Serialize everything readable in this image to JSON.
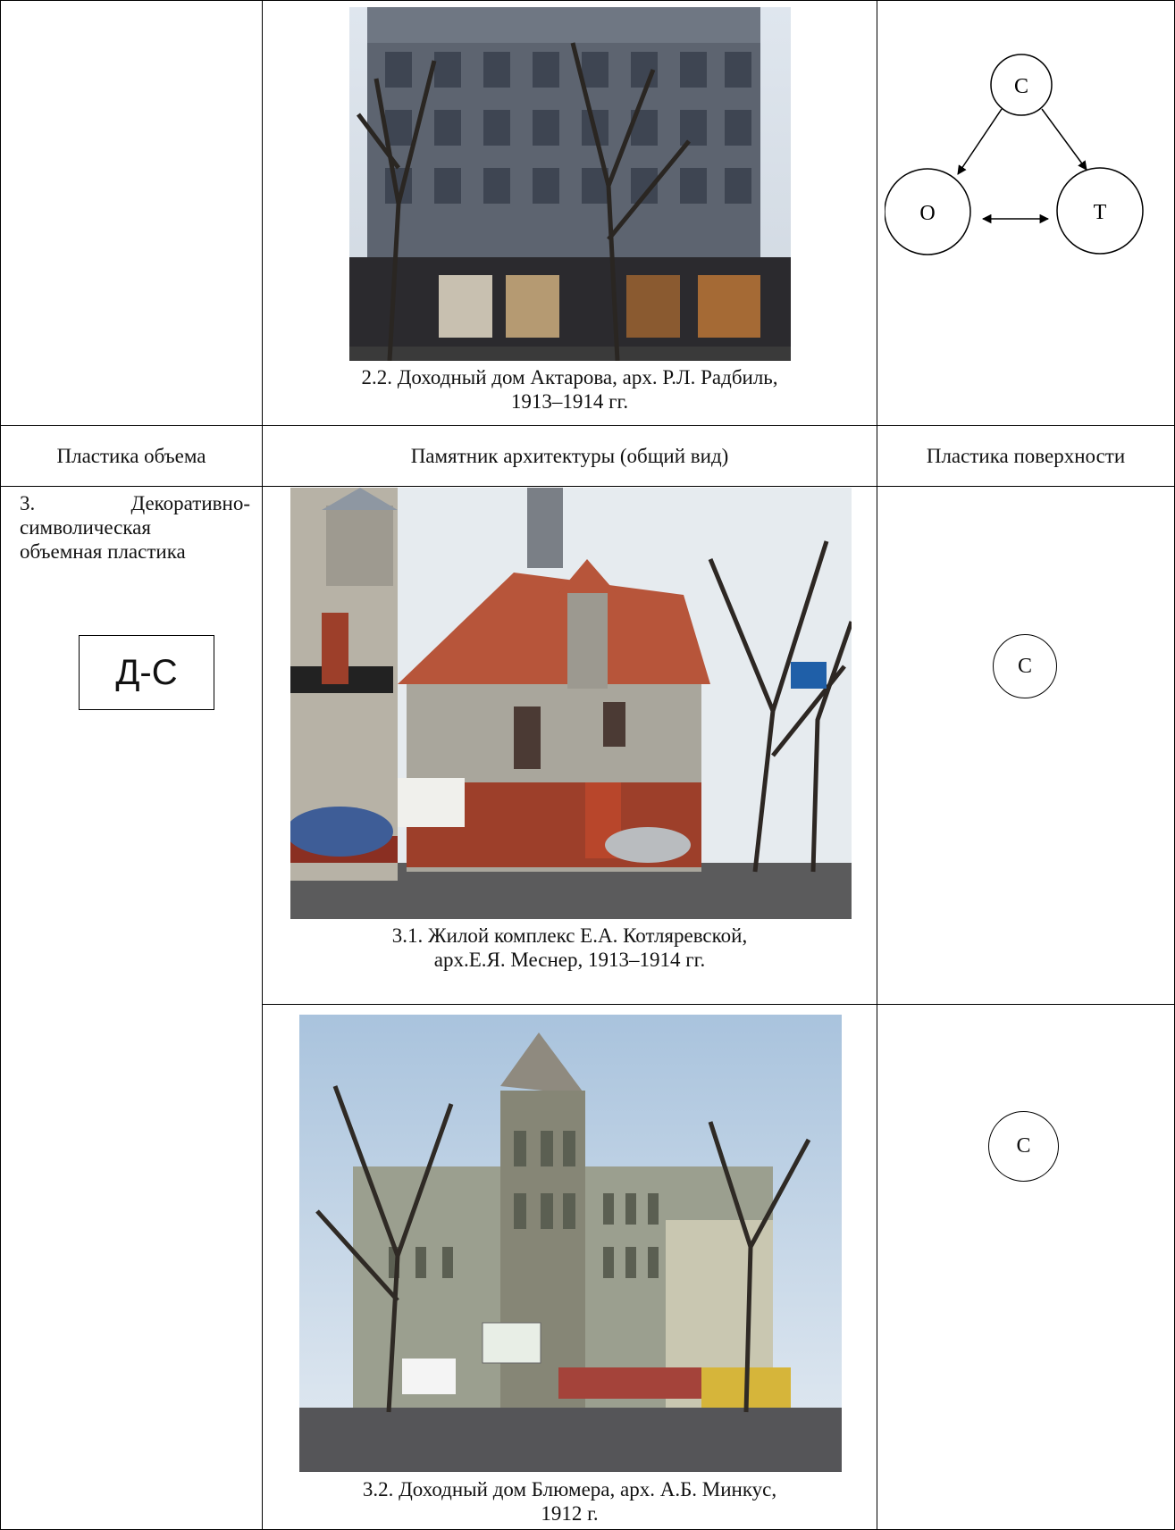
{
  "row1": {
    "caption_line1": "2.2. Доходный дом Актарова, арх. Р.Л. Радбиль,",
    "caption_line2": "1913–1914 гг.",
    "diagram": {
      "top": "С",
      "left": "О",
      "right": "Т"
    }
  },
  "header": {
    "col1": "Пластика объема",
    "col2": "Памятник архитектуры (общий вид)",
    "col3": "Пластика поверхности"
  },
  "row3": {
    "item_number": "3.",
    "item_title_line1": "Декоративно-",
    "item_title_line2": "символическая",
    "item_title_line3": "объемная пластика",
    "code_label": "Д-С",
    "photo1_caption_line1": "3.1. Жилой комплекс Е.А. Котляревской,",
    "photo1_caption_line2": "арх.Е.Я. Меснер, 1913–1914 гг.",
    "surface1": "С",
    "photo2_caption_line1": "3.2. Доходный дом Блюмера, арх. А.Б. Минкус,",
    "photo2_caption_line2": "1912 г.",
    "surface2": "С"
  }
}
